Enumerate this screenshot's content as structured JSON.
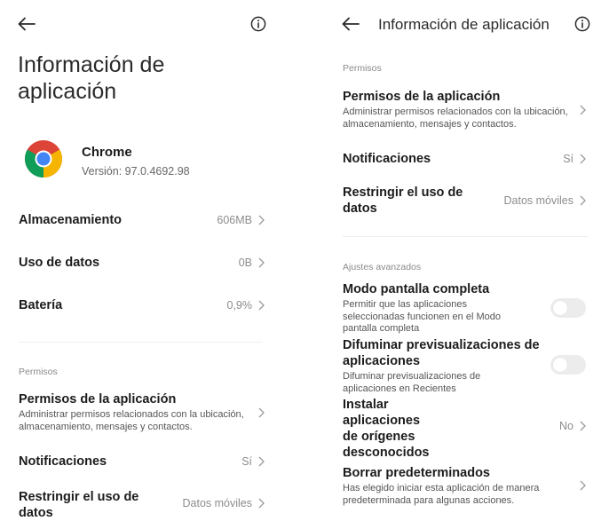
{
  "left": {
    "title": "Información de aplicación",
    "app": {
      "name": "Chrome",
      "version": "Versión: 97.0.4692.98"
    },
    "rows": [
      {
        "label": "Almacenamiento",
        "value": "606MB"
      },
      {
        "label": "Uso de datos",
        "value": "0B"
      },
      {
        "label": "Batería",
        "value": "0,9%"
      }
    ],
    "permissions_section": "Permisos",
    "permissions": {
      "title": "Permisos de la aplicación",
      "subtitle": "Administrar permisos relacionados con la ubicación, almacenamiento, mensajes y contactos."
    },
    "notifications": {
      "label": "Notificaciones",
      "value": "Sí"
    },
    "restrict": {
      "label": "Restringir el uso de datos",
      "value": "Datos móviles"
    }
  },
  "right": {
    "title": "Información de aplicación",
    "permissions_section": "Permisos",
    "permissions": {
      "title": "Permisos de la aplicación",
      "subtitle": "Administrar permisos relacionados con la ubicación, almacenamiento, mensajes y contactos."
    },
    "notifications": {
      "label": "Notificaciones",
      "value": "Sí"
    },
    "restrict": {
      "label": "Restringir el uso de datos",
      "value": "Datos móviles"
    },
    "advanced_section": "Ajustes avanzados",
    "fullscreen": {
      "title": "Modo pantalla completa",
      "subtitle": "Permitir que las aplicaciones seleccionadas funcionen en el Modo pantalla completa",
      "enabled": false
    },
    "blur": {
      "title": "Difuminar previsualizaciones de aplicaciones",
      "subtitle": "Difuminar previsualizaciones de aplicaciones en Recientes",
      "enabled": false
    },
    "unknown_sources": {
      "title": "Instalar aplicaciones de orígenes desconocidos",
      "value": "No"
    },
    "defaults": {
      "title": "Borrar predeterminados",
      "subtitle": "Has elegido iniciar esta aplicación de manera predeterminada para algunas acciones."
    }
  },
  "icons": {
    "back": "back-arrow-icon",
    "info": "info-icon",
    "chevron": "chevron-right-icon",
    "app": "chrome-logo-icon"
  },
  "colors": {
    "chrome_red": "#DB4437",
    "chrome_yellow": "#F4B400",
    "chrome_green": "#0F9D58",
    "chrome_blue": "#4285F4",
    "toggle_off": "#ececec"
  }
}
